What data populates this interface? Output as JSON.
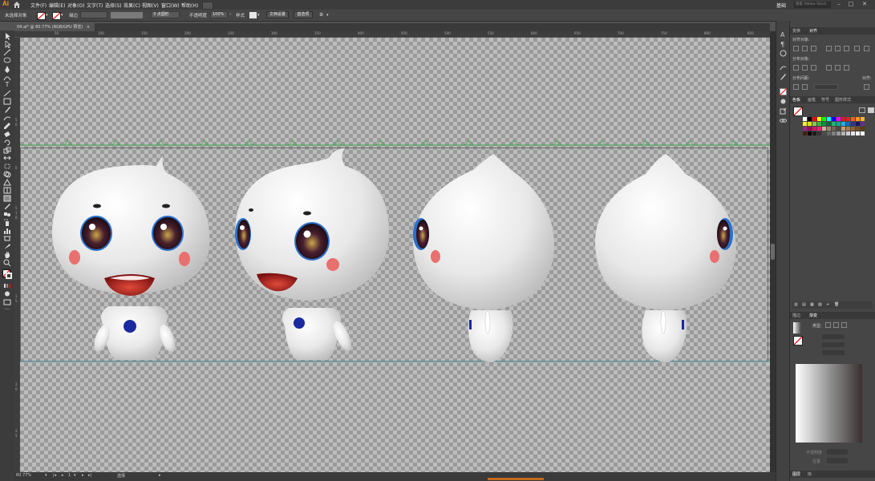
{
  "app": {
    "logo": "Ai"
  },
  "menu": [
    "文件(F)",
    "编辑(E)",
    "对象(O)",
    "文字(T)",
    "选择(S)",
    "效果(C)",
    "视图(V)",
    "窗口(W)",
    "帮助(H)"
  ],
  "workspace": "基础",
  "search_placeholder": "搜索 Adobe Stock",
  "control_bar": {
    "selection_label": "未选择对象",
    "stroke_label": "描边",
    "stroke_stepper": "",
    "brush_value": "3 点圆形",
    "opacity_label": "不透明度",
    "opacity_value": "100%",
    "style_label": "样式",
    "doc_setup_button": "文档设置",
    "preferences_button": "首选项"
  },
  "document_tab": {
    "title": "04.ai* @ 60.77% (RGB/GPU 预览)",
    "close": "×"
  },
  "ruler_ticks": [
    "50",
    "100",
    "150",
    "200",
    "250",
    "300",
    "350",
    "400",
    "450",
    "500",
    "550",
    "600",
    "650",
    "700",
    "750",
    "800",
    "850"
  ],
  "left_ruler_ticks": [
    "5",
    "0",
    "0",
    "5",
    "1",
    "0",
    "1",
    "5",
    "2",
    "0",
    "2",
    "5"
  ],
  "status_bar": {
    "zoom": "60.77%",
    "page": "1",
    "tool": "选择"
  },
  "panels": {
    "top_tabs": [
      "变换",
      "对齐"
    ],
    "align_objects_label": "对齐对象:",
    "distribute_objects_label": "分布对象:",
    "distribute_spacing_label": "分布间距:",
    "align_to_label": "对齐:",
    "swatches_tabs": [
      "色板",
      "画笔",
      "符号"
    ],
    "brush_ref_tab": "图形样式",
    "bottom_tabs": [
      "描边",
      "渐变"
    ],
    "gradient_type_label": "类型:",
    "gradient_tab_bottom": [
      "图层",
      "库"
    ],
    "opacity_label": "不透明度",
    "location_label": "位置"
  },
  "swatch_colors": [
    "#ffffff",
    "#000000",
    "#ff0000",
    "#ffff00",
    "#00ff00",
    "#00ffff",
    "#0000ff",
    "#ff00ff",
    "#c1272d",
    "#ed1c24",
    "#f15a24",
    "#f7931e",
    "#fbb03b",
    "#fcee21",
    "#d9e021",
    "#8cc63f",
    "#39b54a",
    "#009245",
    "#006837",
    "#22b573",
    "#00a99d",
    "#29abe2",
    "#0071bc",
    "#2e3192",
    "#1b1464",
    "#662d91",
    "#93278f",
    "#9e005d",
    "#d4145a",
    "#ed1e79",
    "#c7b299",
    "#998675",
    "#736357",
    "#534741",
    "#c69c6d",
    "#a67c52",
    "#8c6239",
    "#754c24",
    "#603813",
    "#42210b",
    "#000000",
    "#1a1a1a",
    "#333333",
    "#4d4d4d",
    "#666666",
    "#808080",
    "#999999",
    "#b3b3b3",
    "#cccccc",
    "#e6e6e6",
    "#f2f2f2",
    "#ffffff"
  ],
  "accent_color": "#ff9a00"
}
